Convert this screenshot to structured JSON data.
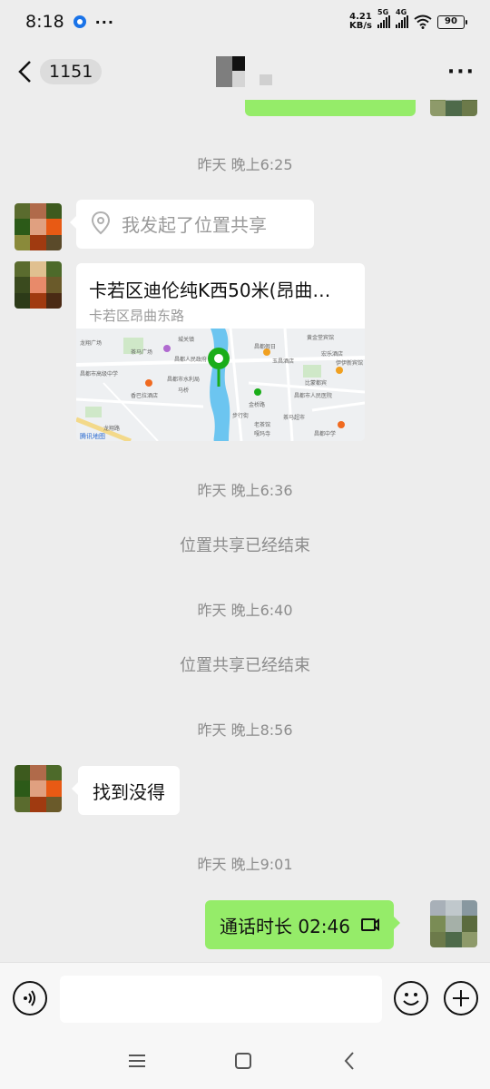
{
  "status_bar": {
    "time": "8:18",
    "more": "···",
    "net_speed_value": "4.21",
    "net_speed_unit": "KB/s",
    "sim1_label": "5G",
    "sim2_label": "4G",
    "battery": "90"
  },
  "nav": {
    "unread_count": "1151",
    "more": "···"
  },
  "messages": {
    "time_1": "昨天 晚上6:25",
    "location_share_text": "我发起了位置共享",
    "location_card_title": "卡若区迪伦纯K西50米(昂曲…",
    "location_card_address": "卡若区昂曲东路",
    "map_brand": "腾讯地图",
    "time_2": "昨天 晚上6:36",
    "system_1": "位置共享已经结束",
    "time_3": "昨天 晚上6:40",
    "system_2": "位置共享已经结束",
    "time_4": "昨天 晚上8:56",
    "text_msg": "找到没得",
    "time_5": "昨天 晚上9:01",
    "call_msg": "通话时长 02:46"
  },
  "map_labels": [
    "龙翔广场",
    "茶马广场",
    "城关镇",
    "昌都市高级中学",
    "黄金堂宾馆",
    "昌都市水利局",
    "昌都人民政府",
    "昌都假日",
    "玉昌酒店",
    "宏乐酒店",
    "香巴拉酒店",
    "比蒙都宾",
    "伊伊新宾馆",
    "昌都市人民医院",
    "金桥路",
    "老茶馆",
    "茶马超市",
    "昌都中学",
    "步行街",
    "马桥",
    "嘎玛寺",
    "龙翔路"
  ],
  "colors": {
    "chat_bg": "#ededed",
    "bubble_green": "#95ec69",
    "bubble_white": "#ffffff",
    "timestamp_text": "#8c8c8c",
    "map_pin": "#1aad19",
    "map_river": "#6cc5f0"
  },
  "icons": {
    "back": "chevron-left-icon",
    "location": "location-pin-icon",
    "call": "phone-call-icon",
    "voice": "voice-icon",
    "emoji": "emoji-icon",
    "plus": "plus-icon",
    "menu": "menu-icon",
    "home": "home-icon",
    "sys_back": "back-icon"
  }
}
